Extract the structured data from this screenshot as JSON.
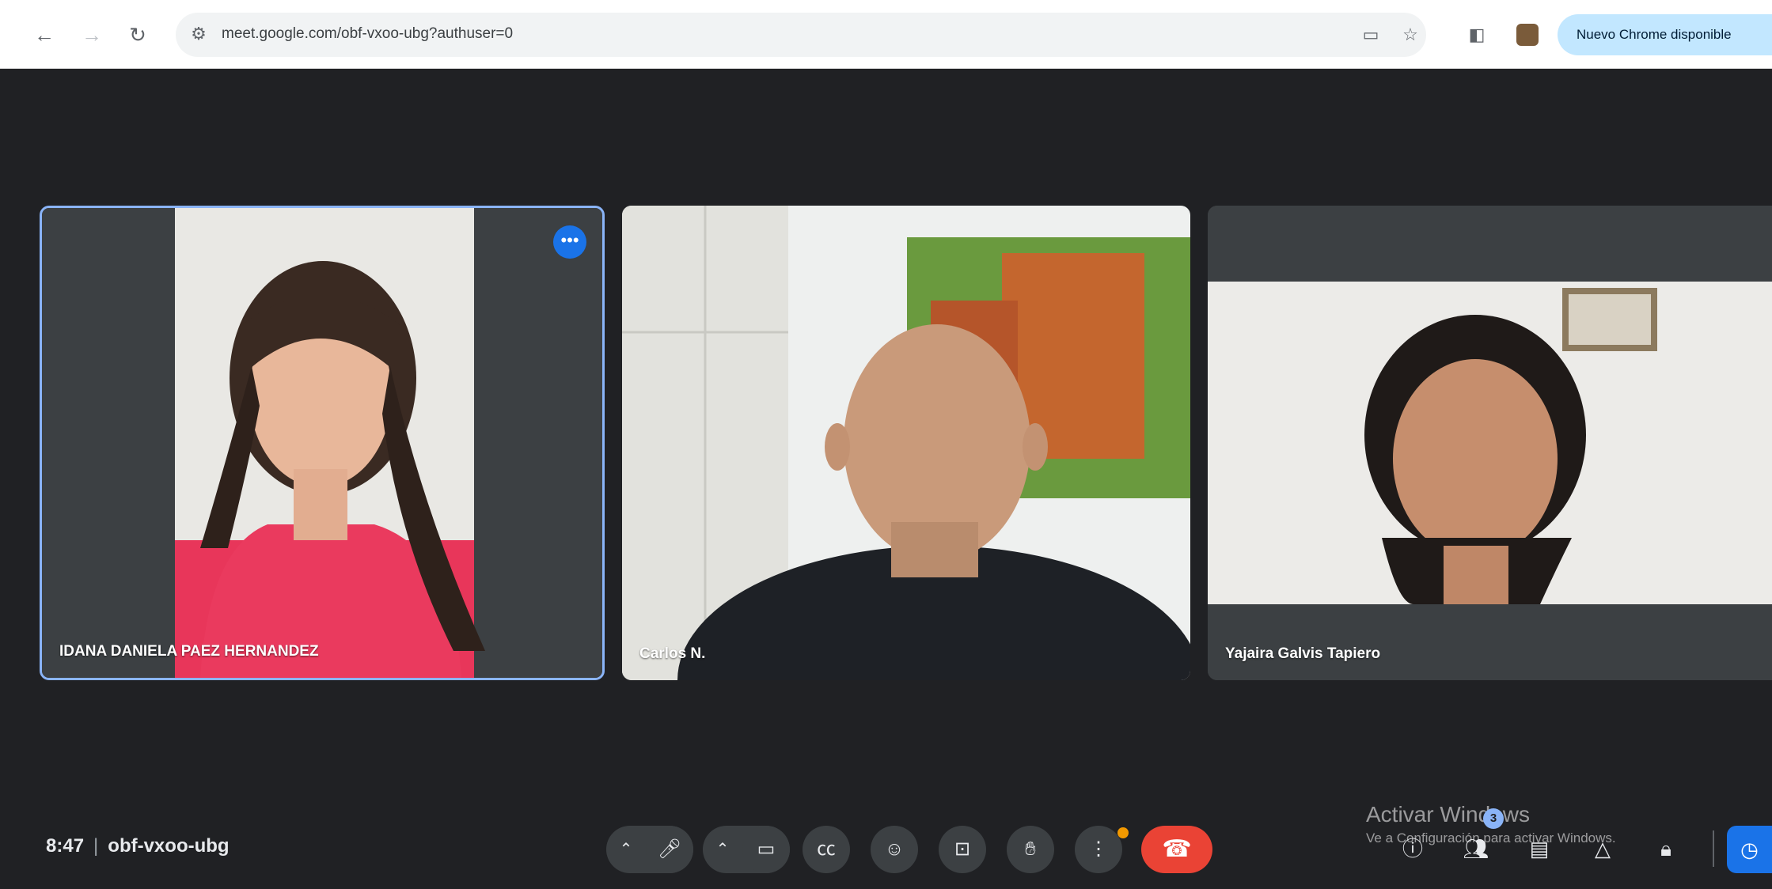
{
  "browser": {
    "url": "meet.google.com/obf-vxoo-ubg?authuser=0",
    "update_label": "Nuevo Chrome disponible"
  },
  "participants": [
    {
      "name": "IDANA DANIELA PAEZ HERNANDEZ",
      "active_speaker": true
    },
    {
      "name": "Carlos N."
    },
    {
      "name": "Yajaira Galvis Tapiero"
    }
  ],
  "meeting": {
    "time": "8:47",
    "separator": "|",
    "code": "obf-vxoo-ubg"
  },
  "controls": {
    "more_options_badge_color": "#f29900",
    "people_count": "3"
  },
  "watermark": {
    "line1": "Activar Windows",
    "line2": "Ve a Configuración para activar Windows."
  },
  "colors": {
    "accent": "#1a73e8",
    "end_call": "#ea4335",
    "active_border": "#8ab4f8"
  }
}
